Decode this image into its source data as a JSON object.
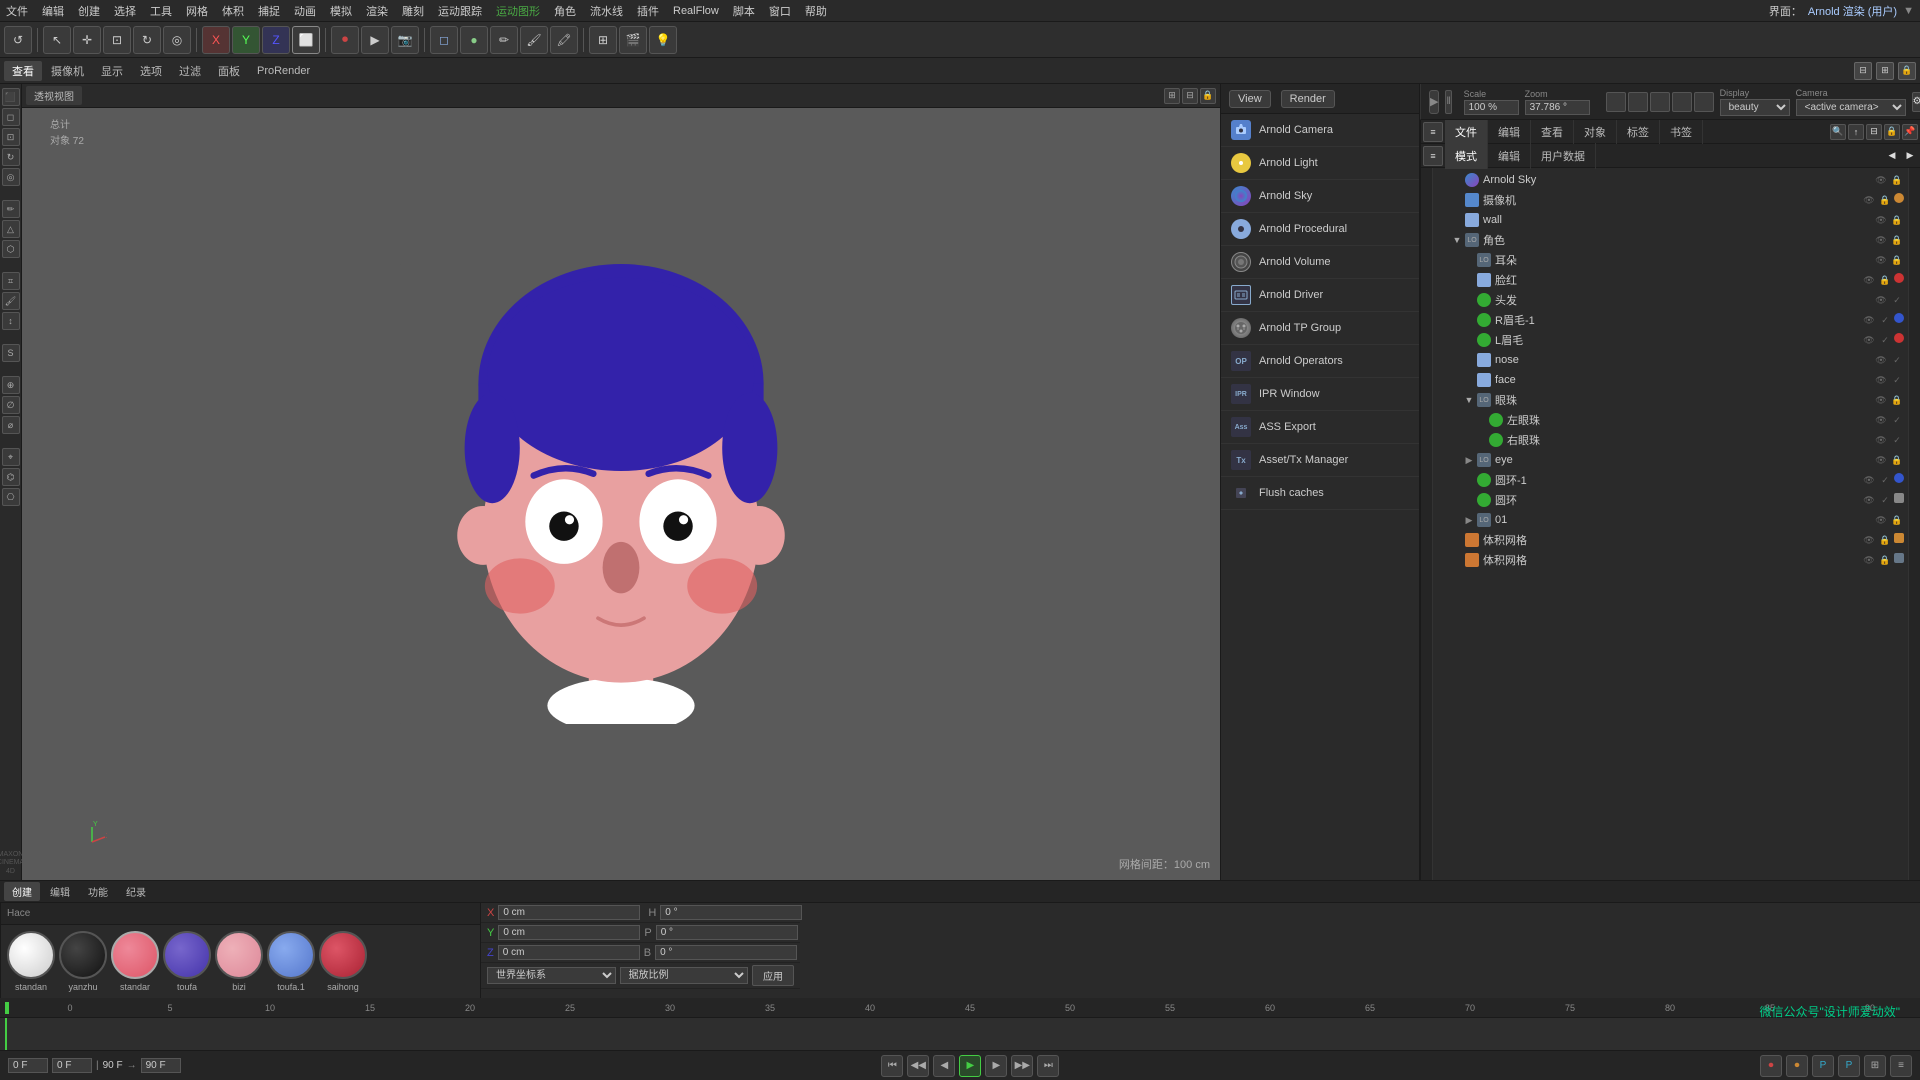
{
  "app": {
    "title": "Cinema 4D",
    "watermark": "微信公众号\"设计师爱动效\""
  },
  "menu_bar": {
    "items": [
      "文件",
      "编辑",
      "创建",
      "选择",
      "工具",
      "网格",
      "体积",
      "捕捉",
      "动画",
      "模拟",
      "渲染",
      "雕刻",
      "运动跟踪",
      "运动图形",
      "角色",
      "流水线",
      "插件",
      "RealFlow",
      "脚本",
      "窗口",
      "帮助"
    ],
    "right_label": "界面：",
    "right_value": "Arnold 渲染 (用户)"
  },
  "viewport_label": "网格间距：100 cm",
  "viewport_info": {
    "total_label": "总计",
    "object_label": "对象",
    "object_count": "72"
  },
  "sub_toolbar": {
    "items": [
      "查看",
      "摄像机",
      "显示",
      "选项",
      "过滤",
      "面板",
      "ProRender"
    ]
  },
  "viewport_tab": "透视视图",
  "arnold_panel": {
    "header": {
      "view_label": "View",
      "render_label": "Render"
    },
    "items": [
      {
        "id": "arnold-camera",
        "label": "Arnold Camera",
        "icon_type": "camera"
      },
      {
        "id": "arnold-light",
        "label": "Arnold Light",
        "icon_type": "light"
      },
      {
        "id": "arnold-sky",
        "label": "Arnold Sky",
        "icon_type": "sky"
      },
      {
        "id": "arnold-procedural",
        "label": "Arnold Procedural",
        "icon_type": "procedural"
      },
      {
        "id": "arnold-volume",
        "label": "Arnold Volume",
        "icon_type": "volume"
      },
      {
        "id": "arnold-driver",
        "label": "Arnold Driver",
        "icon_type": "driver"
      },
      {
        "id": "arnold-tp-group",
        "label": "Arnold TP Group",
        "icon_type": "tp"
      },
      {
        "id": "arnold-operators",
        "label": "Arnold Operators",
        "icon_type": "op"
      },
      {
        "id": "ipr-window",
        "label": "IPR Window",
        "icon_type": "ipr"
      },
      {
        "id": "ass-export",
        "label": "ASS Export",
        "icon_type": "ass"
      },
      {
        "id": "asset-tx",
        "label": "Asset/Tx Manager",
        "icon_type": "tx"
      },
      {
        "id": "flush-caches",
        "label": "Flush caches",
        "icon_type": "flush"
      }
    ]
  },
  "render_settings": {
    "scale_label": "Scale",
    "scale_value": "100 %",
    "zoom_label": "Zoom",
    "zoom_value": "37.786 °",
    "display_label": "Display",
    "display_value": "beauty",
    "camera_label": "Camera",
    "camera_value": "<active camera>"
  },
  "object_panel": {
    "tabs": [
      "文件",
      "编辑",
      "查看",
      "对象",
      "标签",
      "书签"
    ],
    "right_tabs": [
      "模式",
      "编辑",
      "用户数据"
    ],
    "items": [
      {
        "id": "arnold-sky",
        "label": "Arnold Sky",
        "level": 0,
        "has_children": false,
        "icon_color": "#5588cc",
        "icon_type": "sphere"
      },
      {
        "id": "camera",
        "label": "摄像机",
        "level": 0,
        "has_children": false,
        "icon_color": "#88aadd",
        "icon_type": "camera"
      },
      {
        "id": "wall",
        "label": "wall",
        "level": 0,
        "has_children": false,
        "icon_color": "#88aadd",
        "icon_type": "cube"
      },
      {
        "id": "character",
        "label": "角色",
        "level": 0,
        "has_children": true,
        "expanded": true,
        "icon_color": "#88aadd",
        "icon_type": "null"
      },
      {
        "id": "earring",
        "label": "耳朵",
        "level": 1,
        "has_children": false,
        "icon_color": "#88aadd",
        "icon_type": "mesh"
      },
      {
        "id": "cheek-red",
        "label": "脸红",
        "level": 1,
        "has_children": false,
        "icon_color": "#cc3333",
        "icon_type": "mesh",
        "dot": "red"
      },
      {
        "id": "hair",
        "label": "头发",
        "level": 1,
        "has_children": false,
        "icon_color": "#33cc33",
        "icon_type": "mesh",
        "dot": "green"
      },
      {
        "id": "rbrow",
        "label": "R眉毛-1",
        "level": 1,
        "has_children": false,
        "icon_color": "#3355cc",
        "icon_type": "mesh",
        "dot": "blue"
      },
      {
        "id": "lbrow",
        "label": "L眉毛",
        "level": 1,
        "has_children": false,
        "icon_color": "#cc3333",
        "icon_type": "mesh",
        "dot": "red"
      },
      {
        "id": "nose",
        "label": "nose",
        "level": 1,
        "has_children": false,
        "icon_color": "#88aadd",
        "icon_type": "mesh"
      },
      {
        "id": "face",
        "label": "face",
        "level": 1,
        "has_children": false,
        "icon_color": "#88aadd",
        "icon_type": "mesh"
      },
      {
        "id": "eyeballs",
        "label": "眼珠",
        "level": 1,
        "has_children": true,
        "expanded": true,
        "icon_color": "#88aadd",
        "icon_type": "null"
      },
      {
        "id": "left-eye",
        "label": "左眼珠",
        "level": 2,
        "has_children": false,
        "icon_color": "#33cc33",
        "icon_type": "mesh",
        "dot": "green"
      },
      {
        "id": "right-eye",
        "label": "右眼珠",
        "level": 2,
        "has_children": false,
        "icon_color": "#33cc33",
        "icon_type": "mesh",
        "dot": "green"
      },
      {
        "id": "eye",
        "label": "eye",
        "level": 1,
        "has_children": true,
        "expanded": false,
        "icon_color": "#88aadd",
        "icon_type": "null"
      },
      {
        "id": "ring1",
        "label": "圆环-1",
        "level": 1,
        "has_children": false,
        "icon_color": "#3355cc",
        "icon_type": "mesh",
        "dot": "blue"
      },
      {
        "id": "ring",
        "label": "圆环",
        "level": 1,
        "has_children": false,
        "icon_color": "#888",
        "icon_type": "mesh",
        "dot": "gray"
      },
      {
        "id": "01",
        "label": "01",
        "level": 1,
        "has_children": true,
        "expanded": false,
        "icon_color": "#88aadd",
        "icon_type": "null"
      },
      {
        "id": "mesh1",
        "label": "体积网格",
        "level": 0,
        "has_children": false,
        "icon_color": "#cc7733",
        "icon_type": "mesh"
      },
      {
        "id": "mesh2",
        "label": "体积网格",
        "level": 0,
        "has_children": false,
        "icon_color": "#cc7733",
        "icon_type": "mesh"
      }
    ]
  },
  "timeline": {
    "tabs": [
      "创建",
      "编辑",
      "功能",
      "纪录"
    ],
    "frames": [
      "0",
      "5",
      "10",
      "15",
      "20",
      "25",
      "30",
      "35",
      "40",
      "45",
      "50",
      "55",
      "60",
      "65",
      "70",
      "75",
      "80",
      "85",
      "90"
    ],
    "current_frame": "0 F",
    "start_frame": "0 F",
    "end_frame": "90 F",
    "end2": "90 F"
  },
  "materials": {
    "header": "Hace",
    "items": [
      {
        "id": "standan",
        "name": "standan",
        "color": "#e8e8e8",
        "type": "standard"
      },
      {
        "id": "yanzhu",
        "name": "yanzhu",
        "color": "#111111",
        "type": "dark"
      },
      {
        "id": "standar2",
        "name": "standar",
        "color": "#dd6677",
        "type": "pink"
      },
      {
        "id": "toufa",
        "name": "toufa",
        "color": "#5544bb",
        "type": "purple"
      },
      {
        "id": "bizi",
        "name": "bizi",
        "color": "#dd8899",
        "type": "skin"
      },
      {
        "id": "toufa1",
        "name": "toufa.1",
        "color": "#6699dd",
        "type": "blue"
      },
      {
        "id": "saihong",
        "name": "saihong",
        "color": "#cc3344",
        "type": "red"
      }
    ]
  },
  "transform": {
    "x_pos": "0 cm",
    "y_pos": "0 cm",
    "z_pos": "0 cm",
    "x_rot": "0 °",
    "y_rot": "0 °",
    "z_rot": "0 °",
    "h_val": "0 °",
    "p_val": "0 °",
    "b_val": "0 °",
    "coord_system": "世界坐标系",
    "scale_mode": "据放比例",
    "apply_label": "应用"
  }
}
